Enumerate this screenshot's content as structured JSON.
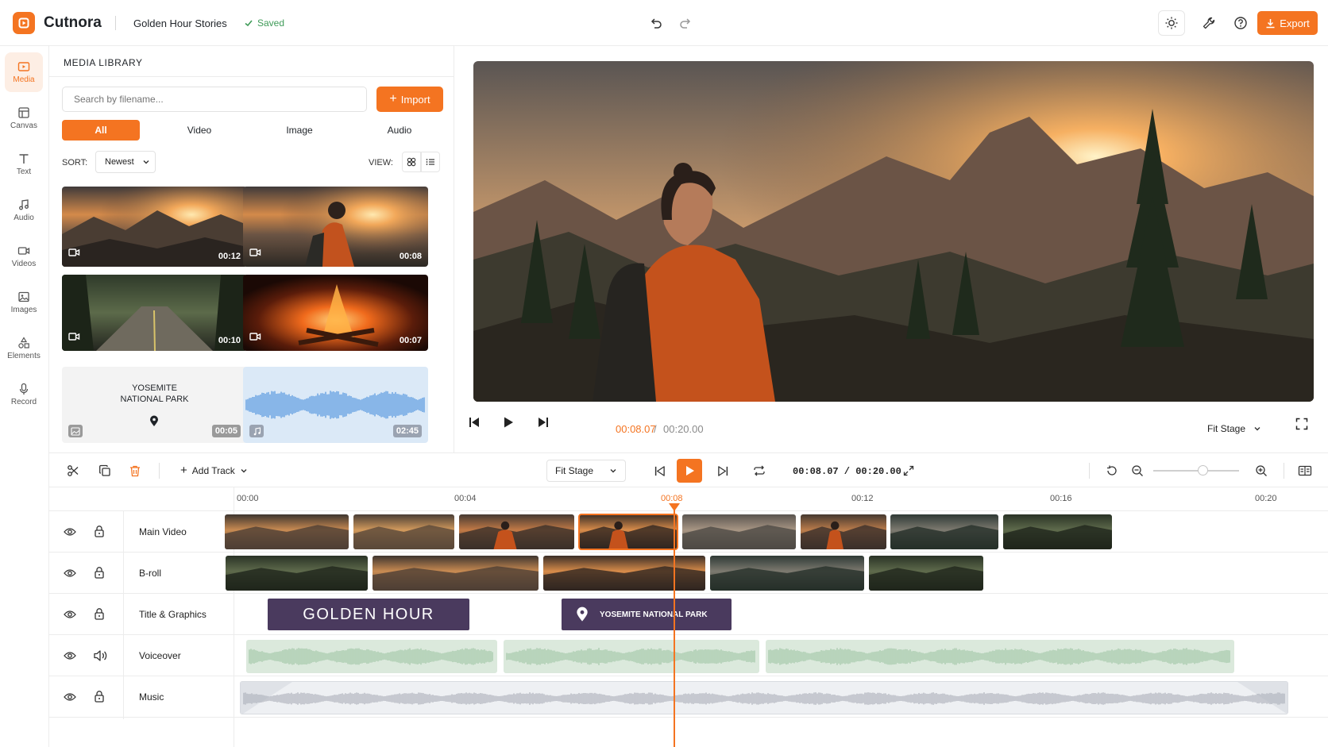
{
  "app": {
    "name": "Cutnora",
    "project": "Golden Hour Stories",
    "status": "Saved"
  },
  "topbar": {
    "export_label": "Export"
  },
  "rail": {
    "items": [
      {
        "label": "Media",
        "icon": "media-icon",
        "active": true
      },
      {
        "label": "Canvas",
        "icon": "canvas-icon"
      },
      {
        "label": "Text",
        "icon": "text-icon"
      },
      {
        "label": "Audio",
        "icon": "audio-note-icon"
      },
      {
        "label": "Videos",
        "icon": "video-camera-icon"
      },
      {
        "label": "Images",
        "icon": "image-icon"
      },
      {
        "label": "Elements",
        "icon": "shapes-icon"
      },
      {
        "label": "Record",
        "icon": "microphone-icon"
      }
    ]
  },
  "media": {
    "title": "MEDIA LIBRARY",
    "search_placeholder": "Search by filename...",
    "import_label": "Import",
    "filters": [
      "All",
      "Video",
      "Image",
      "Audio"
    ],
    "active_filter": "All",
    "sort_label": "SORT:",
    "sort_value": "Newest",
    "view_label": "VIEW:",
    "items": [
      {
        "duration": "00:12",
        "kind": "video"
      },
      {
        "duration": "00:08",
        "kind": "video"
      },
      {
        "duration": "00:10",
        "kind": "video"
      },
      {
        "duration": "00:07",
        "kind": "video"
      },
      {
        "duration": "00:05",
        "kind": "image",
        "title_line1": "YOSEMITE",
        "title_line2": "NATIONAL PARK"
      },
      {
        "duration": "02:45",
        "kind": "audio"
      }
    ]
  },
  "player": {
    "current": "00:08.07",
    "separator": "/",
    "total": "00:20.00",
    "fit": "Fit Stage"
  },
  "timeline": {
    "add_track_label": "Add Track",
    "fit": "Fit Stage",
    "timecode": "00:08.07 / 00:20.00",
    "zoom_level": 0.5,
    "ruler": [
      "00:00",
      "00:04",
      "00:08",
      "00:12",
      "00:16",
      "00:20"
    ],
    "playhead_time": "00:08",
    "tracks": [
      {
        "name": "Main Video",
        "type": "video"
      },
      {
        "name": "B-roll",
        "type": "video"
      },
      {
        "name": "Title & Graphics",
        "type": "graphics"
      },
      {
        "name": "Voiceover",
        "type": "voice"
      },
      {
        "name": "Music",
        "type": "music"
      }
    ],
    "graphics": {
      "title_clip": "GOLDEN HOUR",
      "location_clip": "YOSEMITE NATIONAL PARK"
    }
  },
  "colors": {
    "accent": "#f47421",
    "graphics_clip": "#4a3a5e",
    "voice_wave": "#a6c9aa",
    "music_wave": "#b0b4bd"
  }
}
